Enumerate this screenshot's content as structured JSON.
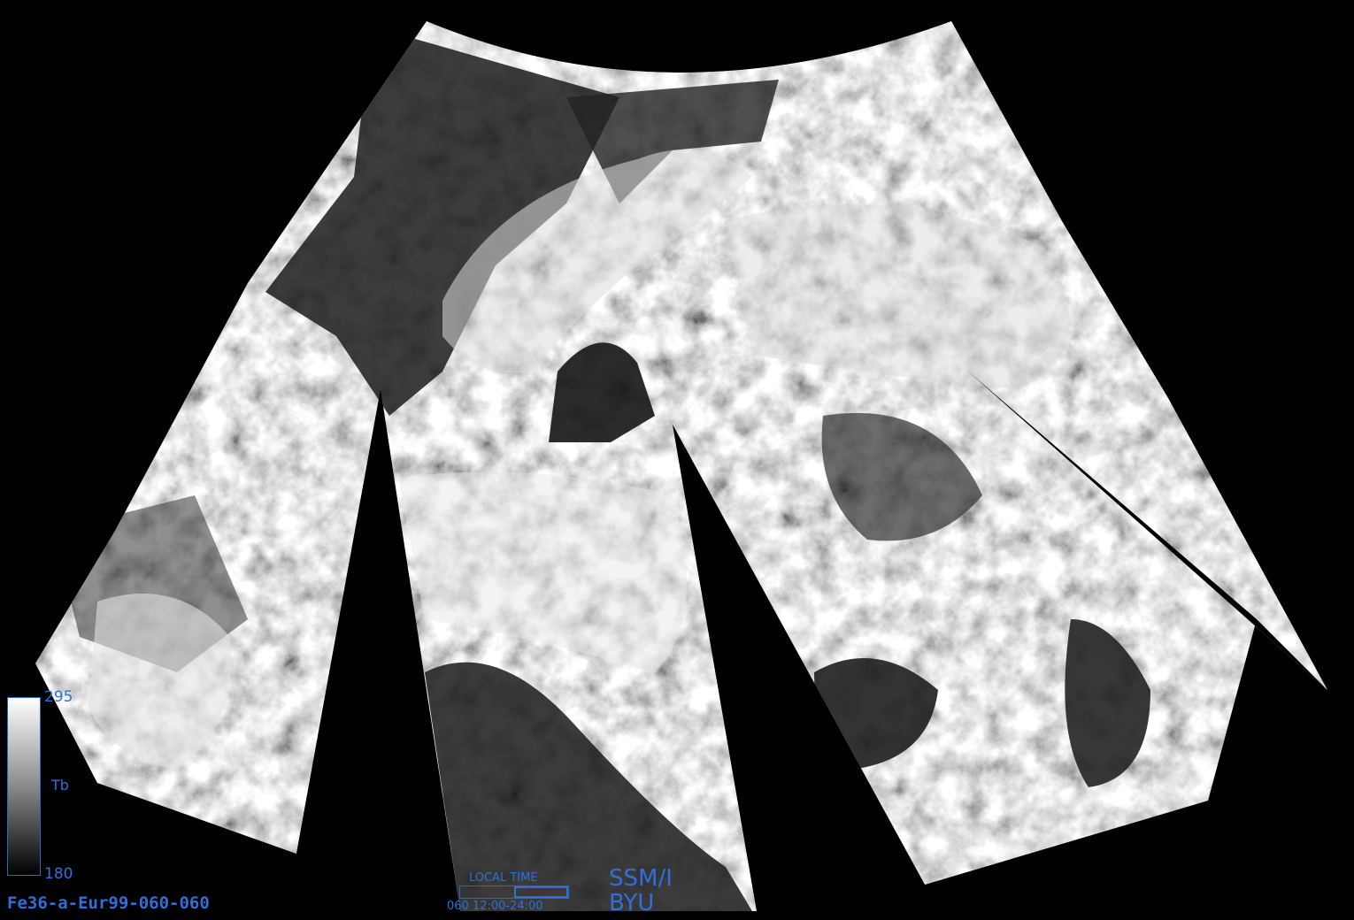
{
  "image": {
    "product_id": "Fe36-a-Eur99-060-060",
    "sensor": "SSM/I",
    "organization": "BYU"
  },
  "colorbar": {
    "max_label": "295",
    "min_label": "180",
    "unit_label": "Tb",
    "max_value": 295,
    "min_value": 180
  },
  "local_time": {
    "title": "LOCAL TIME",
    "range_text": "060  12:00-24:00",
    "fill_fraction_start": 0.5,
    "fill_fraction_end": 1.0
  },
  "colors": {
    "annotation": "#2f6fdc",
    "background": "#000000"
  },
  "icons": {
    "colorbar": "grayscale-gradient"
  }
}
